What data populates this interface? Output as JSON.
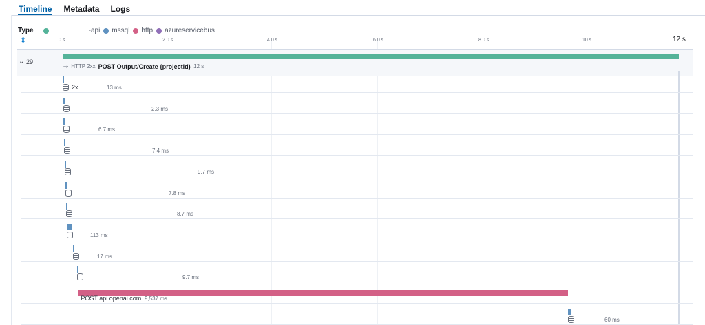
{
  "tabs": [
    {
      "label": "Timeline",
      "active": true
    },
    {
      "label": "Metadata"
    },
    {
      "label": "Logs"
    }
  ],
  "legend": {
    "title": "Type",
    "items": [
      {
        "label": "-api",
        "color": "#54b399"
      },
      {
        "label": "mssql",
        "color": "#6092c0"
      },
      {
        "label": "http",
        "color": "#d36086"
      },
      {
        "label": "azureservicebus",
        "color": "#9170b8"
      }
    ]
  },
  "axis": {
    "ticks": [
      "0 s",
      "2.0 s",
      "4.0 s",
      "6.0 s",
      "8.0 s",
      "10 s"
    ],
    "end": "12 s",
    "max_seconds": 12
  },
  "root": {
    "count": "29",
    "status": "HTTP 2xx",
    "name": "POST Output/Create {projectId}",
    "duration": "12 s",
    "start_s": 0,
    "duration_s": 12,
    "color": "#54b399"
  },
  "spans": [
    {
      "name": "2x",
      "duration": "13 ms",
      "start_s": 0.0,
      "duration_s": 0.013,
      "type": "mssql"
    },
    {
      "name": "",
      "duration": "2.3 ms",
      "start_s": 0.01,
      "duration_s": 0.0023,
      "type": "mssql"
    },
    {
      "name": "",
      "duration": "6.7 ms",
      "start_s": 0.02,
      "duration_s": 0.0067,
      "type": "mssql"
    },
    {
      "name": "",
      "duration": "7.4 ms",
      "start_s": 0.03,
      "duration_s": 0.0074,
      "type": "mssql"
    },
    {
      "name": "",
      "duration": "9.7 ms",
      "start_s": 0.04,
      "duration_s": 0.0097,
      "type": "mssql"
    },
    {
      "name": "",
      "duration": "7.8 ms",
      "start_s": 0.06,
      "duration_s": 0.0078,
      "type": "mssql"
    },
    {
      "name": "",
      "duration": "8.7 ms",
      "start_s": 0.07,
      "duration_s": 0.0087,
      "type": "mssql"
    },
    {
      "name": "",
      "duration": "113 ms",
      "start_s": 0.08,
      "duration_s": 0.113,
      "type": "mssql"
    },
    {
      "name": "",
      "duration": "17 ms",
      "start_s": 0.2,
      "duration_s": 0.017,
      "type": "mssql"
    },
    {
      "name": "",
      "duration": "9.7 ms",
      "start_s": 0.28,
      "duration_s": 0.0097,
      "type": "mssql"
    },
    {
      "name": "POST api.openai.com",
      "duration": "9,537 ms",
      "start_s": 0.3,
      "duration_s": 9.537,
      "type": "http"
    },
    {
      "name": "",
      "duration": "60 ms",
      "start_s": 9.84,
      "duration_s": 0.06,
      "type": "mssql"
    }
  ]
}
